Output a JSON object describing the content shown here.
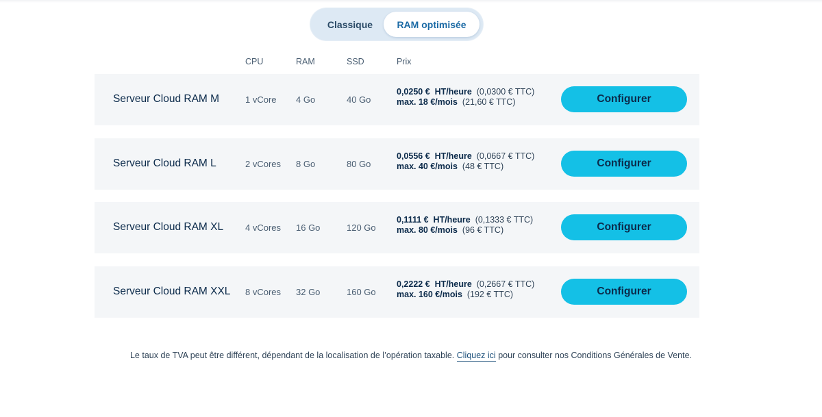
{
  "toggle": {
    "classic_label": "Classique",
    "ram_label": "RAM optimisée"
  },
  "table": {
    "headers": [
      "CPU",
      "RAM",
      "SSD",
      "Prix"
    ],
    "rows": [
      {
        "name": "Serveur Cloud RAM M",
        "cpu": "1 vCore",
        "ram": "4 Go",
        "ssd": "40 Go",
        "price_hour": "0,0250 €",
        "price_hour_unit": "HT/heure",
        "price_hour_ttc": "(0,0300 € TTC)",
        "price_month": "max. 18 €/mois",
        "price_month_ttc": "(21,60 € TTC)",
        "button": "Configurer"
      },
      {
        "name": "Serveur Cloud RAM L",
        "cpu": "2 vCores",
        "ram": "8 Go",
        "ssd": "80 Go",
        "price_hour": "0,0556 €",
        "price_hour_unit": "HT/heure",
        "price_hour_ttc": "(0,0667 € TTC)",
        "price_month": "max. 40 €/mois",
        "price_month_ttc": "(48 € TTC)",
        "button": "Configurer"
      },
      {
        "name": "Serveur Cloud RAM XL",
        "cpu": "4 vCores",
        "ram": "16 Go",
        "ssd": "120 Go",
        "price_hour": "0,1111 €",
        "price_hour_unit": "HT/heure",
        "price_hour_ttc": "(0,1333 € TTC)",
        "price_month": "max. 80 €/mois",
        "price_month_ttc": "(96 € TTC)",
        "button": "Configurer"
      },
      {
        "name": "Serveur Cloud RAM XXL",
        "cpu": "8 vCores",
        "ram": "32 Go",
        "ssd": "160 Go",
        "price_hour": "0,2222 €",
        "price_hour_unit": "HT/heure",
        "price_hour_ttc": "(0,2667 € TTC)",
        "price_month": "max. 160 €/mois",
        "price_month_ttc": "(192 € TTC)",
        "button": "Configurer"
      }
    ]
  },
  "footnote": {
    "before": "Le taux de TVA peut être différent, dépendant de la localisation de l’opération taxable.",
    "link": "Cliquez ici",
    "after": "pour consulter nos Conditions Générales de Vente."
  },
  "colors": {
    "accent": "#14c0e6",
    "toggle_bg": "#dde9f4",
    "row_bg": "#f4f6f8"
  }
}
